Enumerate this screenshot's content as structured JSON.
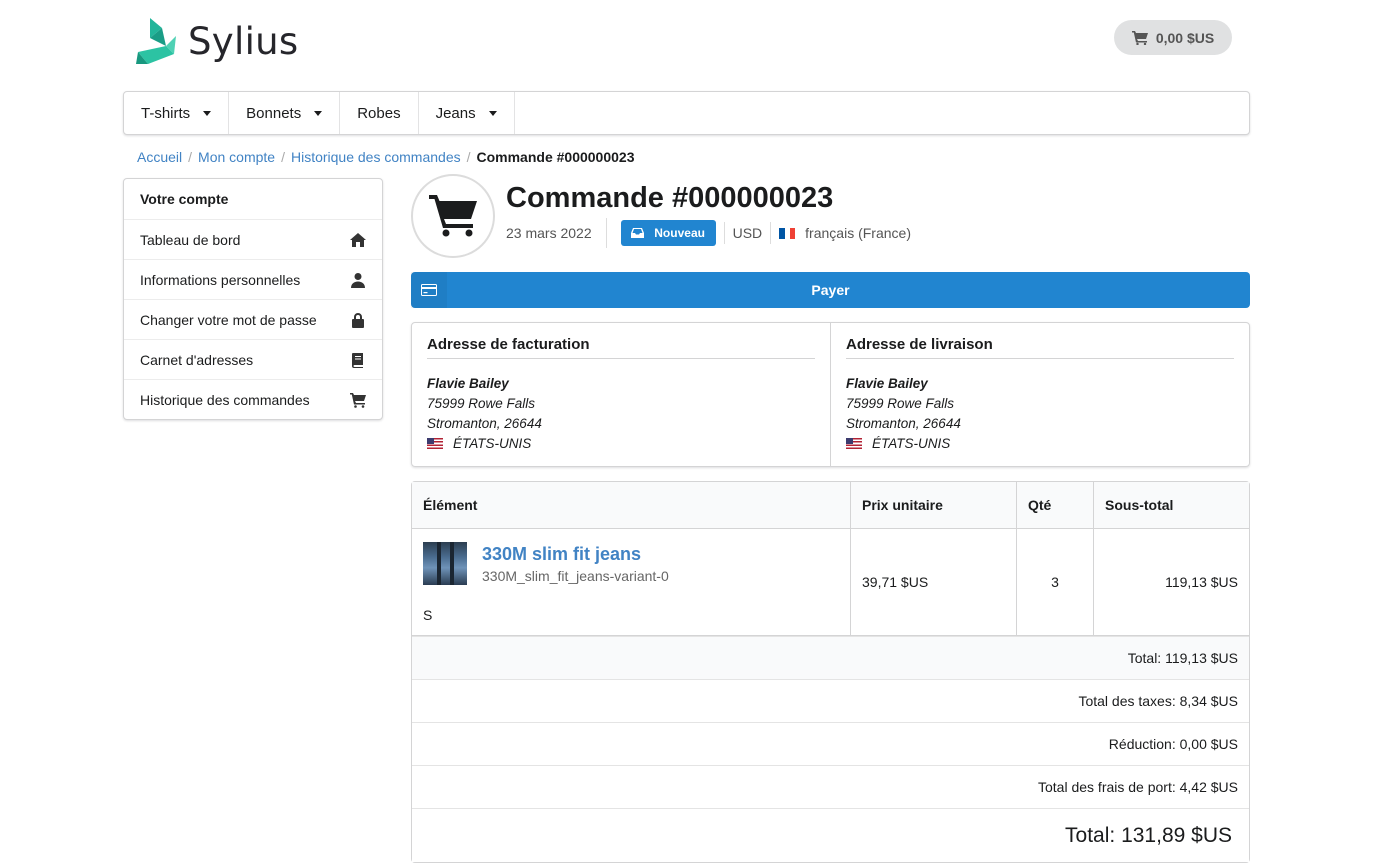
{
  "header": {
    "logo_text": "Sylius",
    "cart_total": "0,00 $US"
  },
  "menu": [
    {
      "label": "T-shirts",
      "has_dropdown": true
    },
    {
      "label": "Bonnets",
      "has_dropdown": true
    },
    {
      "label": "Robes",
      "has_dropdown": false
    },
    {
      "label": "Jeans",
      "has_dropdown": true
    }
  ],
  "breadcrumb": {
    "home": "Accueil",
    "account": "Mon compte",
    "history": "Historique des commandes",
    "current": "Commande #000000023"
  },
  "sidebar": {
    "title": "Votre compte",
    "items": [
      {
        "label": "Tableau de bord",
        "icon": "home-icon"
      },
      {
        "label": "Informations personnelles",
        "icon": "user-icon"
      },
      {
        "label": "Changer votre mot de passe",
        "icon": "lock-icon"
      },
      {
        "label": "Carnet d'adresses",
        "icon": "book-icon"
      },
      {
        "label": "Historique des commandes",
        "icon": "cart-icon"
      }
    ]
  },
  "order": {
    "title": "Commande #000000023",
    "date": "23 mars 2022",
    "status": "Nouveau",
    "currency": "USD",
    "locale": "français (France)"
  },
  "pay_button": "Payer",
  "billing": {
    "heading": "Adresse de facturation",
    "name": "Flavie Bailey",
    "street": "75999 Rowe Falls",
    "city": "Stromanton, 26644",
    "country": "ÉTATS-UNIS"
  },
  "shipping": {
    "heading": "Adresse de livraison",
    "name": "Flavie Bailey",
    "street": "75999 Rowe Falls",
    "city": "Stromanton, 26644",
    "country": "ÉTATS-UNIS"
  },
  "table": {
    "headers": {
      "item": "Élément",
      "unit_price": "Prix unitaire",
      "qty": "Qté",
      "subtotal": "Sous-total"
    },
    "rows": [
      {
        "name": "330M slim fit jeans",
        "variant": "330M_slim_fit_jeans-variant-0",
        "option": "S",
        "unit_price": "39,71 $US",
        "qty": "3",
        "subtotal": "119,13 $US"
      }
    ]
  },
  "totals": {
    "items_total": "Total: 119,13 $US",
    "tax_total": "Total des taxes: 8,34 $US",
    "discount": "Réduction: 0,00 $US",
    "shipping_total": "Total des frais de port: 4,42 $US",
    "grand_total": "Total: 131,89 $US"
  },
  "colors": {
    "primary": "#2185d0",
    "link": "#4183c4",
    "logo_teal": "#1abb9c"
  }
}
